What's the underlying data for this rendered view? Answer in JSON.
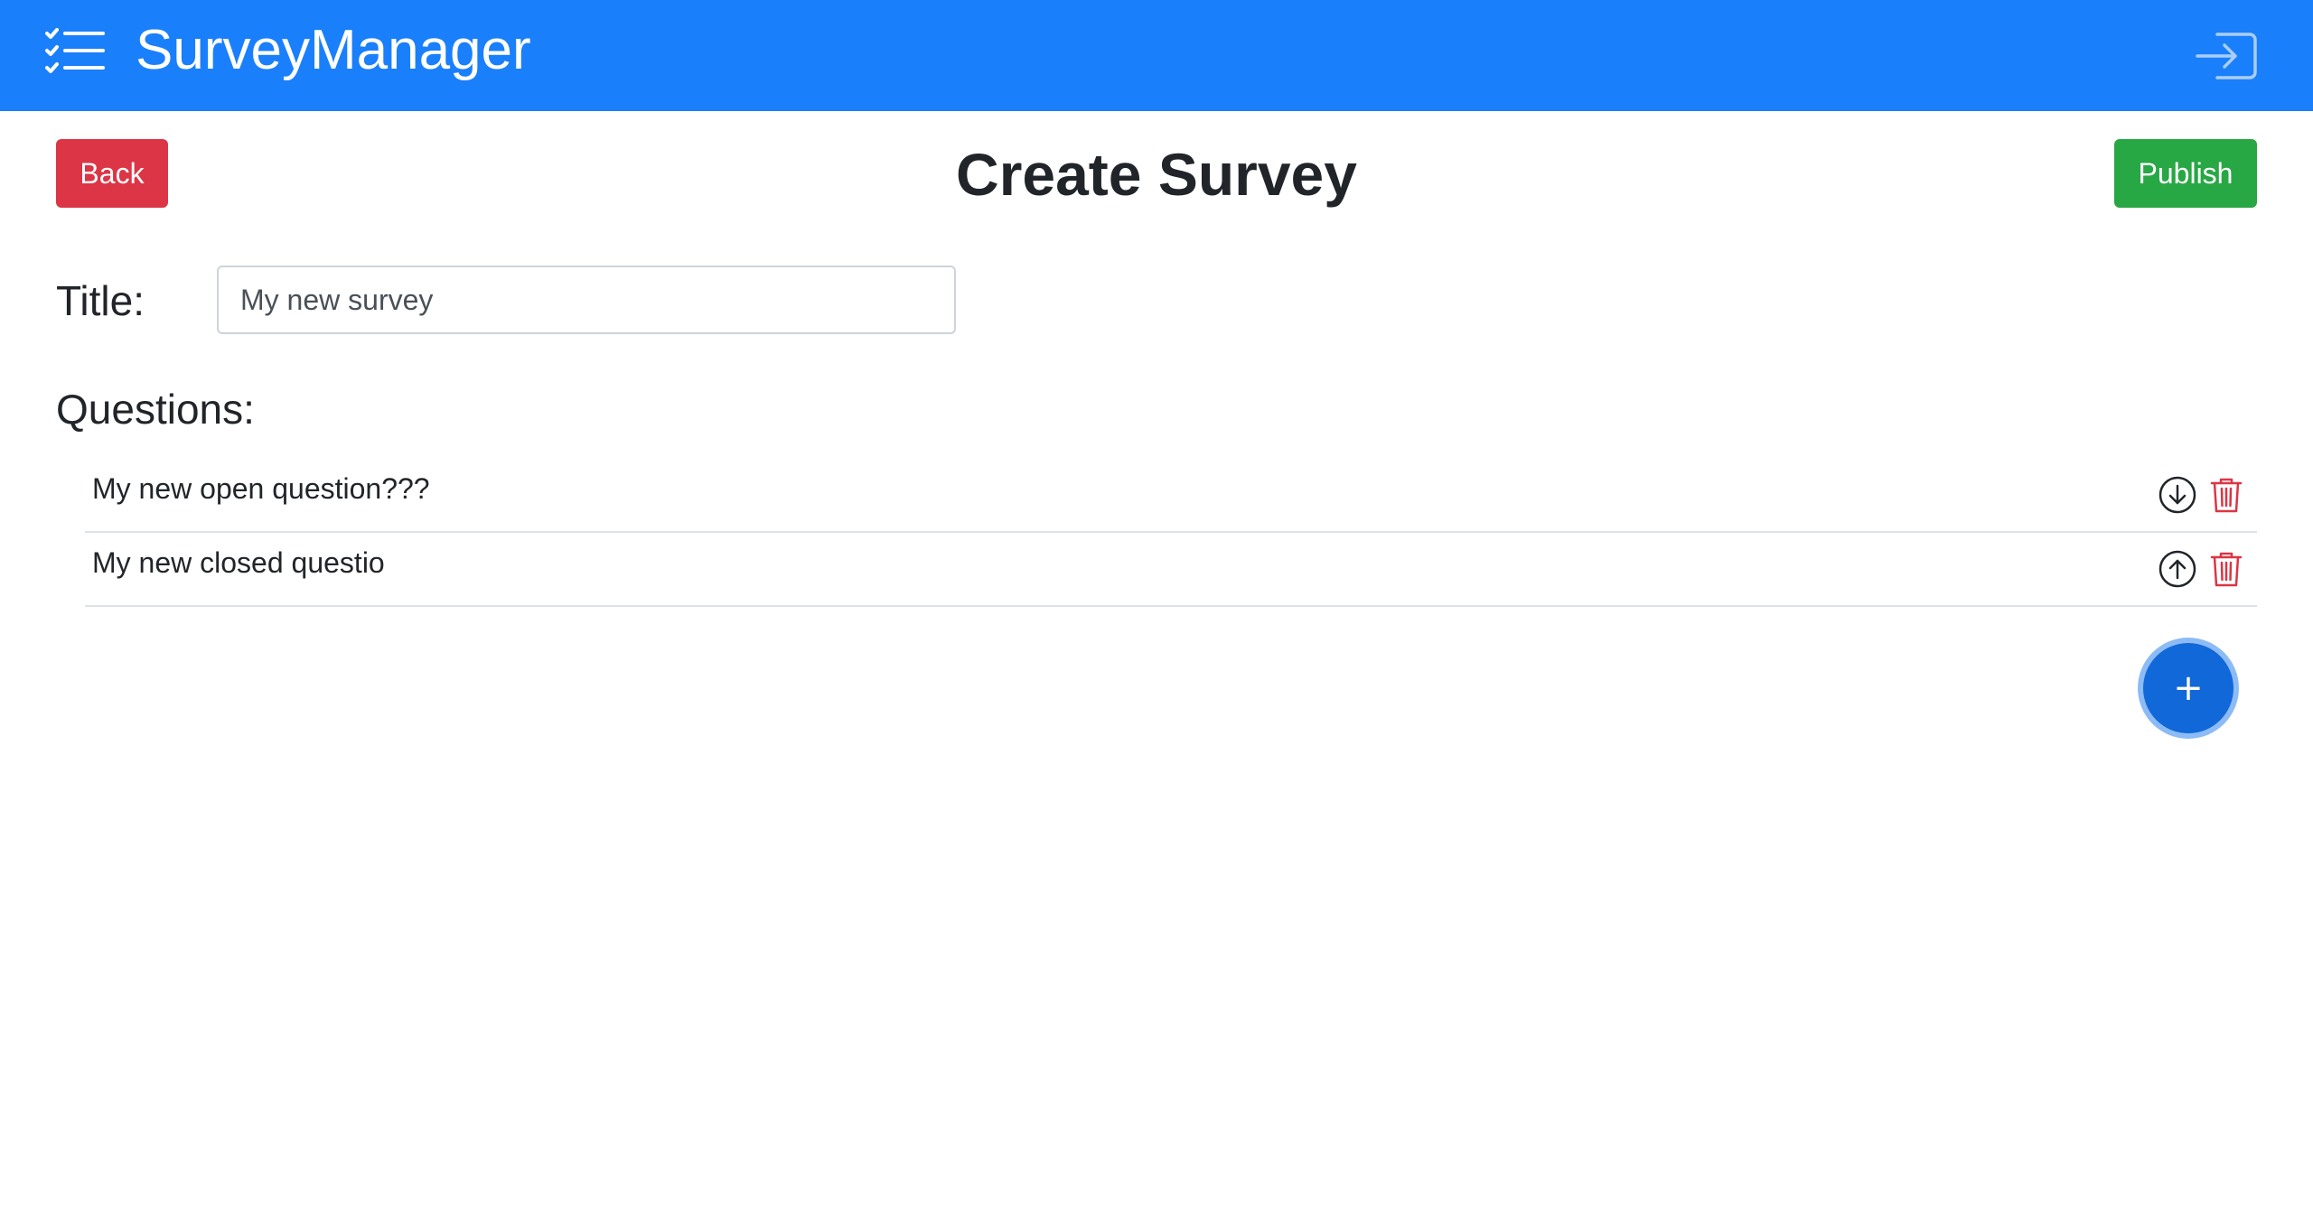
{
  "app": {
    "brand": "SurveyManager",
    "brand_icon": "checklist-icon",
    "logout_icon": "box-arrow-in-right-icon",
    "colors": {
      "navbar": "#1a7ffb",
      "back": "#dc3545",
      "publish": "#28a745",
      "fab": "#1168d8",
      "delete": "#dc3545"
    }
  },
  "header": {
    "back_label": "Back",
    "title": "Create Survey",
    "publish_label": "Publish"
  },
  "form": {
    "title_label": "Title:",
    "title_value": "My new survey",
    "questions_heading": "Questions:"
  },
  "questions": [
    {
      "text": "My new open question???",
      "move_icon": "arrow-down-circle-icon",
      "delete_icon": "trash-icon"
    },
    {
      "text": "My new closed questio",
      "move_icon": "arrow-up-circle-icon",
      "delete_icon": "trash-icon"
    }
  ],
  "fab": {
    "label": "+",
    "icon": "plus-icon"
  }
}
